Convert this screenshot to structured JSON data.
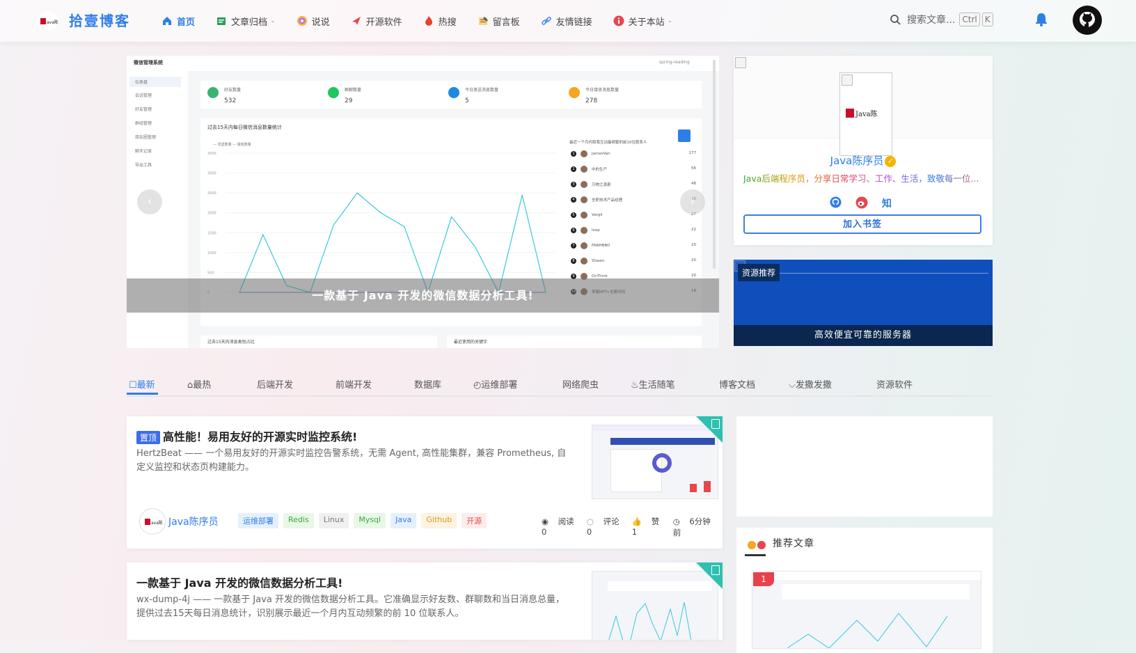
{
  "header": {
    "site_title": "拾壹博客",
    "nav": [
      {
        "label": "首页",
        "icon": "home-icon",
        "active": true
      },
      {
        "label": "文章归档",
        "icon": "archive-icon",
        "dropdown": true
      },
      {
        "label": "说说",
        "icon": "chat-icon"
      },
      {
        "label": "开源软件",
        "icon": "rocket-icon"
      },
      {
        "label": "热搜",
        "icon": "fire-icon"
      },
      {
        "label": "留言板",
        "icon": "guestbook-icon"
      },
      {
        "label": "友情链接",
        "icon": "link-icon"
      },
      {
        "label": "关于本站",
        "icon": "info-icon",
        "dropdown": true
      }
    ],
    "search_placeholder": "搜索文章...",
    "kbd_ctrl": "Ctrl",
    "kbd_k": "K"
  },
  "carousel": {
    "caption": "一款基于 Java 开发的微信数据分析工具!",
    "prev": "‹",
    "next": "›",
    "screenshot": {
      "app_title": "微信管理系统",
      "user_label": "spring-reading",
      "side_items": [
        "仪表盘",
        "会话管理",
        "好友管理",
        "群组管理",
        "朋友圈管理",
        "聊天记录",
        "导出工具"
      ],
      "stats": [
        {
          "label": "好友数量",
          "value": "532",
          "color": "#3cb371"
        },
        {
          "label": "群聊数量",
          "value": "29",
          "color": "#22c55e"
        },
        {
          "label": "今日发送消息数量",
          "value": "5",
          "color": "#1e88e5"
        },
        {
          "label": "今日接收消息数量",
          "value": "278",
          "color": "#f5a623"
        }
      ],
      "chart_title": "过去15天内每日微信消息数量统计",
      "legend": "— 发送数量   — 接收数量",
      "y_ticks": [
        "3500",
        "3000",
        "2500",
        "2000",
        "1500",
        "1000",
        "500",
        "0"
      ],
      "chart_points": [
        0,
        1450,
        170,
        0,
        1700,
        2500,
        2000,
        1650,
        0,
        1900,
        1150,
        0,
        2450,
        0
      ],
      "contacts_title": "最近一个月内和我互动最频繁的前10位联系人",
      "contacts": [
        {
          "rank": "1",
          "name": "JamesVan",
          "value": "177"
        },
        {
          "rank": "2",
          "name": "中的生产",
          "value": "56"
        },
        {
          "rank": "3",
          "name": "万物之源泉",
          "value": "48"
        },
        {
          "rank": "4",
          "name": "全职技术产品经理",
          "value": "28"
        },
        {
          "rank": "5",
          "name": "Vergil",
          "value": "27"
        },
        {
          "rank": "6",
          "name": "loop",
          "value": "22"
        },
        {
          "rank": "7",
          "name": "FANHBBO",
          "value": "20"
        },
        {
          "rank": "8",
          "name": "Shawn",
          "value": "20"
        },
        {
          "rank": "9",
          "name": "OnThink",
          "value": "20"
        },
        {
          "rank": "10",
          "name": "掌握NFT+全套时间",
          "value": "18"
        }
      ],
      "bottom_left": "过去15天内消息类别占比",
      "bottom_right": "最近使用的关键字"
    }
  },
  "profile": {
    "name": "Java陈序员",
    "motto": "Java后端程序员，分享日常学习、工作、生活，致敬每一位...",
    "social": [
      "github-icon",
      "weibo-icon",
      "zhihu-icon"
    ],
    "zhihu_label": "知",
    "bookmark_label": "加入书签",
    "logo_text": "Java陈"
  },
  "resource": {
    "tag": "资源推荐",
    "caption": "高效便宜可靠的服务器"
  },
  "tabs": [
    {
      "label": "最新",
      "icon": "new-icon",
      "active": true
    },
    {
      "label": "最热",
      "icon": "hot-icon"
    },
    {
      "label": "后端开发"
    },
    {
      "label": "前端开发"
    },
    {
      "label": "数据库"
    },
    {
      "label": "运维部署",
      "icon": "clock-icon"
    },
    {
      "label": "网络爬虫"
    },
    {
      "label": "生活随笔",
      "icon": "cake-icon"
    },
    {
      "label": "博客文档"
    },
    {
      "label": "发撒发撒",
      "icon": "chevron-icon"
    },
    {
      "label": "资源软件"
    }
  ],
  "articles": [
    {
      "pin_label": "置顶",
      "title": "高性能！易用友好的开源实时监控系统!",
      "desc": "HertzBeat —— 一个易用友好的开源实时监控告警系统，无需 Agent, 高性能集群，兼容 Prometheus, 自定义监控和状态页构建能力。",
      "author": "Java陈序员",
      "tags": [
        {
          "label": "运维部署",
          "color": "#2e7ee8",
          "bg": "#e6f0fd"
        },
        {
          "label": "Redis",
          "color": "#3aa83a",
          "bg": "#e9f7e7"
        },
        {
          "label": "Linux",
          "color": "#777777",
          "bg": "#f0f0f0"
        },
        {
          "label": "Mysql",
          "color": "#3aa83a",
          "bg": "#e9f7e7"
        },
        {
          "label": "Java",
          "color": "#2e7ee8",
          "bg": "#e6f0fd"
        },
        {
          "label": "Github",
          "color": "#d89a22",
          "bg": "#fdf3e1"
        },
        {
          "label": "开源",
          "color": "#e5484d",
          "bg": "#fdecec"
        }
      ],
      "meta": {
        "read": "阅读 0",
        "comment": "评论 0",
        "like": "赞 1",
        "time": "6分钟前"
      }
    },
    {
      "title": "一款基于 Java 开发的微信数据分析工具!",
      "desc": "wx-dump-4j —— 一款基于 Java 开发的微信数据分析工具。它准确显示好友数、群聊数和当日消息总量，提供过去15天每日消息统计，识别展示最近一个月内互动频繁的前 10 位联系人。"
    }
  ],
  "recommend": {
    "title": "推荐文章",
    "badge": "1"
  }
}
